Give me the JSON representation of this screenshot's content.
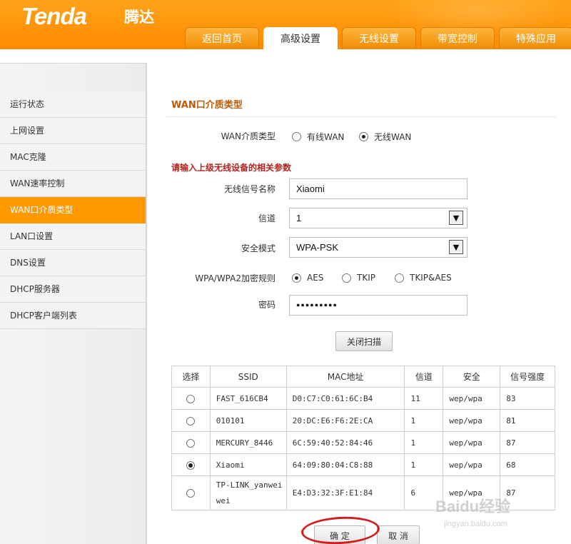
{
  "header": {
    "logo": "Tenda",
    "logo_cn": "腾达",
    "tabs": [
      {
        "label": "返回首页"
      },
      {
        "label": "高级设置",
        "active": true
      },
      {
        "label": "无线设置"
      },
      {
        "label": "带宽控制"
      },
      {
        "label": "特殊应用"
      }
    ]
  },
  "sidebar": {
    "items": [
      {
        "label": "运行状态"
      },
      {
        "label": "上网设置"
      },
      {
        "label": "MAC克隆"
      },
      {
        "label": "WAN速率控制"
      },
      {
        "label": "WAN口介质类型",
        "active": true
      },
      {
        "label": "LAN口设置"
      },
      {
        "label": "DNS设置"
      },
      {
        "label": "DHCP服务器"
      },
      {
        "label": "DHCP客户端列表"
      }
    ]
  },
  "main": {
    "title": "WAN口介质类型",
    "wan_type": {
      "label": "WAN介质类型",
      "options": [
        "有线WAN",
        "无线WAN"
      ],
      "selected": "无线WAN"
    },
    "notice": "请输入上级无线设备的相关参数",
    "ssid": {
      "label": "无线信号名称",
      "value": "Xiaomi"
    },
    "channel": {
      "label": "信道",
      "value": "1"
    },
    "security": {
      "label": "安全模式",
      "value": "WPA-PSK"
    },
    "encryption": {
      "label": "WPA/WPA2加密规则",
      "options": [
        "AES",
        "TKIP",
        "TKIP&AES"
      ],
      "selected": "AES"
    },
    "password": {
      "label": "密码",
      "value": "●●●●●●●●●"
    },
    "scan_button": "关闭扫描",
    "table": {
      "headers": [
        "选择",
        "SSID",
        "MAC地址",
        "信道",
        "安全",
        "信号强度"
      ],
      "rows": [
        {
          "ssid": "FAST_616CB4",
          "mac": "D0:C7:C0:61:6C:B4",
          "channel": "11",
          "security": "wep/wpa",
          "signal": "83",
          "selected": false
        },
        {
          "ssid": "010101",
          "mac": "20:DC:E6:F6:2E:CA",
          "channel": "1",
          "security": "wep/wpa",
          "signal": "81",
          "selected": false
        },
        {
          "ssid": "MERCURY_8446",
          "mac": "6C:59:40:52:84:46",
          "channel": "1",
          "security": "wep/wpa",
          "signal": "87",
          "selected": false
        },
        {
          "ssid": "Xiaomi",
          "mac": "64:09:80:04:C8:88",
          "channel": "1",
          "security": "wep/wpa",
          "signal": "68",
          "selected": true
        },
        {
          "ssid": "TP-LINK_yanweiwei",
          "mac": "E4:D3:32:3F:E1:84",
          "channel": "6",
          "security": "wep/wpa",
          "signal": "87",
          "selected": false
        }
      ]
    },
    "confirm_button": "确 定",
    "cancel_button": "取 消"
  },
  "watermark": {
    "text": "Baidu经验",
    "url_text": "jingyan.baidu.com"
  }
}
